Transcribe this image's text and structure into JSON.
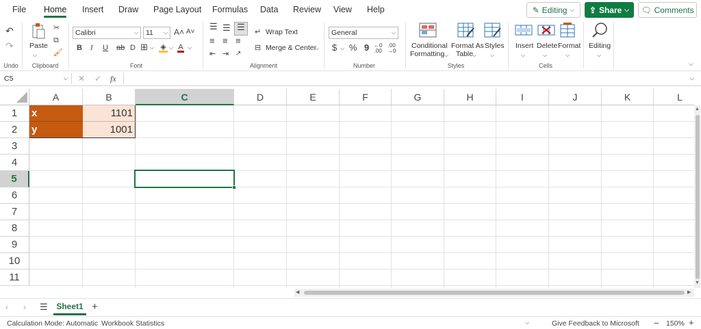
{
  "menu": {
    "tabs": [
      "File",
      "Home",
      "Insert",
      "Draw",
      "Page Layout",
      "Formulas",
      "Data",
      "Review",
      "View",
      "Help"
    ],
    "active_tab": "Home",
    "editing_label": "Editing",
    "share_label": "Share",
    "comments_label": "Comments"
  },
  "ribbon": {
    "undo_group": "Undo",
    "clipboard": {
      "group": "Clipboard",
      "paste": "Paste"
    },
    "font": {
      "group": "Font",
      "family": "Calibri",
      "size": "11",
      "bold": "B",
      "italic": "I",
      "underline": "U"
    },
    "alignment": {
      "group": "Alignment",
      "wrap_text": "Wrap Text",
      "merge_center": "Merge & Center"
    },
    "number": {
      "group": "Number",
      "format": "General",
      "currency": "$",
      "percent": "%",
      "comma": "9"
    },
    "styles": {
      "group": "Styles",
      "conditional_1": "Conditional",
      "conditional_2": "Formatting",
      "format_as_1": "Format As",
      "format_as_2": "Table",
      "styles_label": "Styles"
    },
    "cells": {
      "group": "Cells",
      "insert": "Insert",
      "delete": "Delete",
      "format": "Format"
    },
    "editing": {
      "label": "Editing"
    }
  },
  "formula_bar": {
    "name_box": "C5",
    "fx": "fx",
    "content": ""
  },
  "grid": {
    "columns": [
      "A",
      "B",
      "C",
      "D",
      "E",
      "F",
      "G",
      "H",
      "I",
      "J",
      "K",
      "L"
    ],
    "rows": [
      "1",
      "2",
      "3",
      "4",
      "5",
      "6",
      "7",
      "8",
      "9",
      "10",
      "11"
    ],
    "selected_column": "C",
    "selected_row": "5",
    "cells": {
      "A1": "x",
      "B1": "1101",
      "A2": "y",
      "B2": "1001"
    }
  },
  "colors": {
    "accent": "#217346",
    "header_fill": "#c55a11",
    "value_fill": "#fbe4d5"
  },
  "sheets": {
    "tabs": [
      "Sheet1"
    ],
    "active": "Sheet1"
  },
  "status": {
    "calc_mode": "Calculation Mode: Automatic",
    "workbook_stats": "Workbook Statistics",
    "feedback": "Give Feedback to Microsoft",
    "zoom": "150%"
  }
}
